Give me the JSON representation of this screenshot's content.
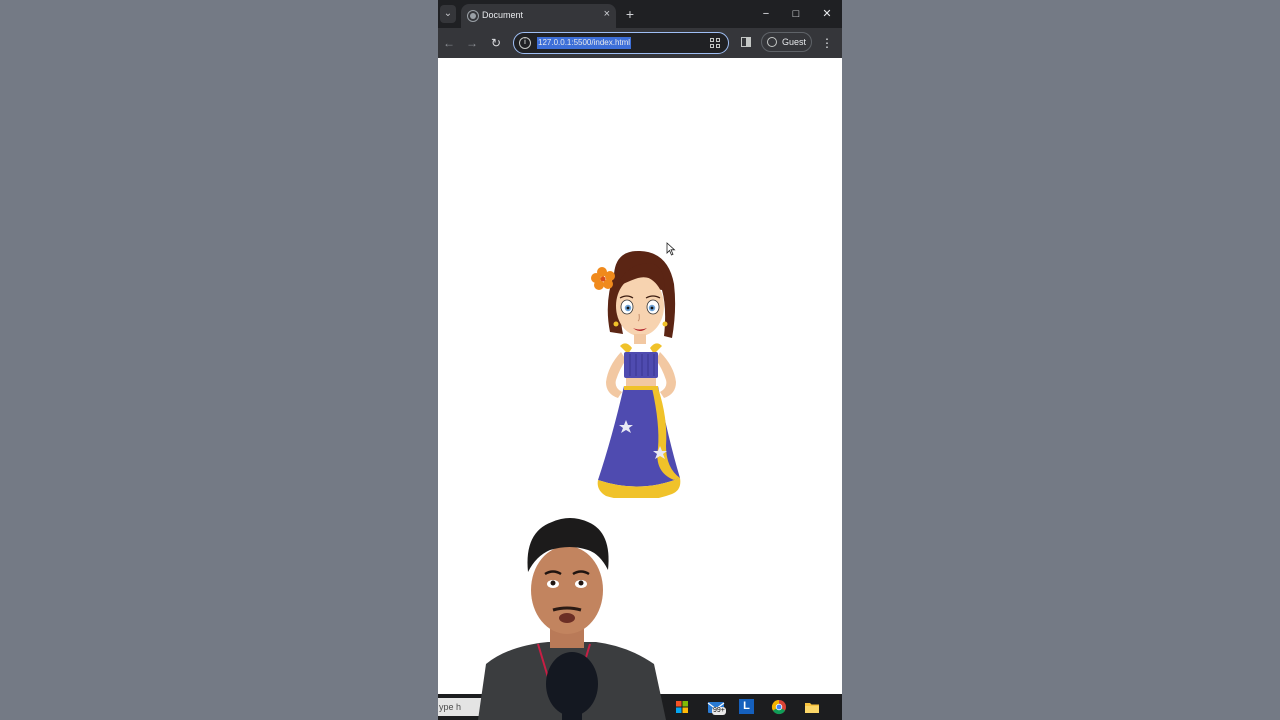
{
  "browser": {
    "tab": {
      "title": "Document",
      "close": "×"
    },
    "new_tab": "+",
    "window": {
      "minimize": "−",
      "maximize": "□",
      "close": "✕"
    },
    "nav": {
      "back": "←",
      "forward": "→",
      "reload": "↻"
    },
    "address": {
      "url": "127.0.0.1:5500/index.html"
    },
    "profile": {
      "label": "Guest"
    },
    "menu": "⋮"
  },
  "taskbar": {
    "search_text": "ype h",
    "notification_badge": "99+",
    "pinned_app_letter": "L"
  },
  "icons": [
    "tab-search-icon",
    "globe-icon",
    "info-icon",
    "qr-code-icon",
    "side-panel-icon",
    "profile-icon",
    "more-menu-icon",
    "mouse-cursor-icon",
    "start-icon",
    "mail-icon",
    "chrome-icon",
    "file-explorer-icon"
  ],
  "colors": {
    "tabbar": "#1f2023",
    "toolbar": "#35363a",
    "url_selection": "#3d6fd8",
    "desktop": "#747a85",
    "dress": "#4f4bb0",
    "gold": "#f0c22a",
    "hair": "#5b2514",
    "flower": "#f08a1c"
  }
}
